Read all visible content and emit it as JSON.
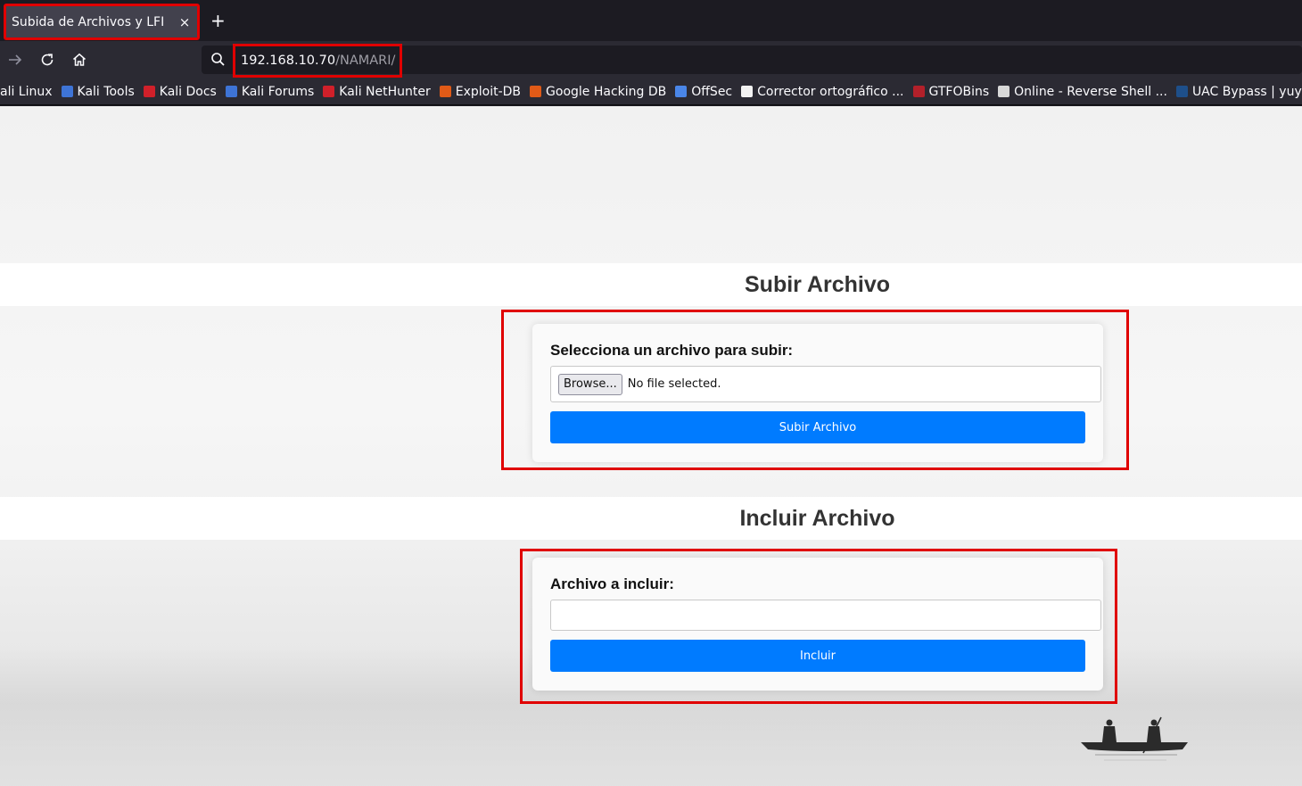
{
  "browser": {
    "tab_title": "Subida de Archivos y LFI",
    "tab_close": "×",
    "new_tab": "+",
    "url_host": "192.168.10.70",
    "url_path": "/NAMARI/"
  },
  "bookmarks": [
    {
      "label": "ali Linux",
      "icon": "kali-linux-icon",
      "color": "#2a2a2a"
    },
    {
      "label": "Kali Tools",
      "icon": "kali-tools-icon",
      "color": "#3e74d6"
    },
    {
      "label": "Kali Docs",
      "icon": "kali-docs-icon",
      "color": "#d0202a"
    },
    {
      "label": "Kali Forums",
      "icon": "kali-forums-icon",
      "color": "#3e74d6"
    },
    {
      "label": "Kali NetHunter",
      "icon": "kali-nethunter-icon",
      "color": "#d0202a"
    },
    {
      "label": "Exploit-DB",
      "icon": "exploit-db-icon",
      "color": "#e05a17"
    },
    {
      "label": "Google Hacking DB",
      "icon": "google-hacking-db-icon",
      "color": "#e05a17"
    },
    {
      "label": "OffSec",
      "icon": "offsec-icon",
      "color": "#4a86e8"
    },
    {
      "label": "Corrector ortográfico ...",
      "icon": "corrector-icon",
      "color": "#f2f2f2"
    },
    {
      "label": "GTFOBins",
      "icon": "gtfobins-icon",
      "color": "#b3202a"
    },
    {
      "label": "Online - Reverse Shell ...",
      "icon": "skull-icon",
      "color": "#d8d8d8"
    },
    {
      "label": "UAC Bypass | yuyud",
      "icon": "uac-bypass-icon",
      "color": "#1e4f8a"
    }
  ],
  "upload": {
    "heading": "Subir Archivo",
    "label": "Selecciona un archivo para subir:",
    "browse_label": "Browse...",
    "file_status": "No file selected.",
    "submit_label": "Subir Archivo"
  },
  "include": {
    "heading": "Incluir Archivo",
    "label": "Archivo a incluir:",
    "input_value": "",
    "submit_label": "Incluir"
  },
  "colors": {
    "highlight": "#e00000",
    "primary_button": "#007bff"
  }
}
